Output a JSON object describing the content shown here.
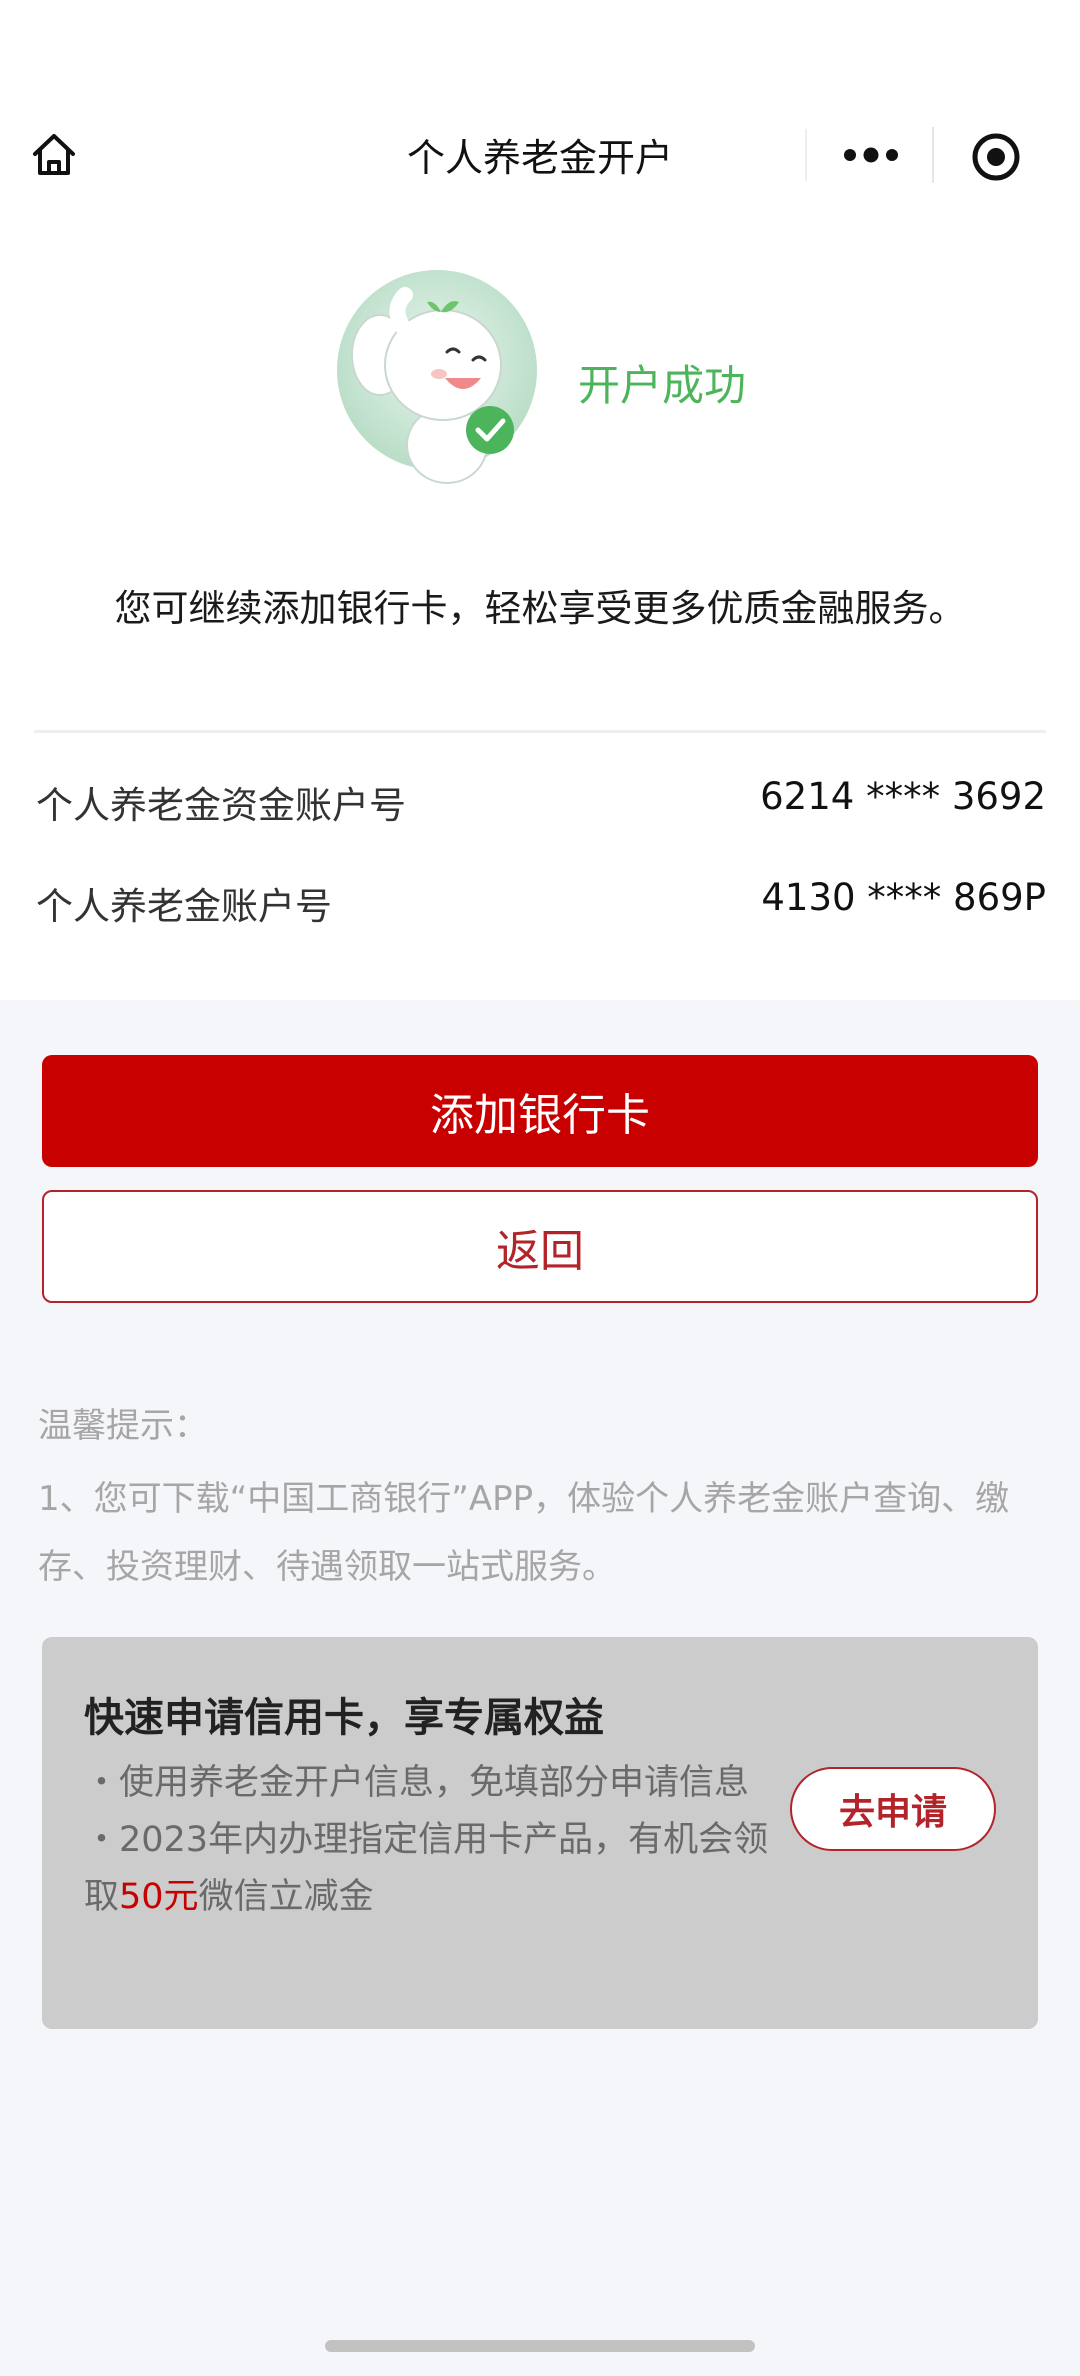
{
  "nav": {
    "title": "个人养老金开户",
    "home_icon": "home-icon",
    "more_icon": "more-dots-icon",
    "close_icon": "target-close-icon"
  },
  "success": {
    "mascot": "elephant-mascot-with-check",
    "status": "开户成功",
    "message": "您可继续添加银行卡，轻松享受更多优质金融服务。"
  },
  "accounts": [
    {
      "label": "个人养老金资金账户号",
      "value": "6214 **** 3692"
    },
    {
      "label": "个人养老金账户号",
      "value": "4130 **** 869P"
    }
  ],
  "actions": {
    "add_card": "添加银行卡",
    "back": "返回"
  },
  "tips": {
    "title": "温馨提示：",
    "items": [
      "1、您可下载“中国工商银行”APP，体验个人养老金账户查询、缴存、投资理财、待遇领取一站式服务。"
    ]
  },
  "promo": {
    "title": "快速申请信用卡，享专属权益",
    "bullet1": "・使用养老金开户信息，免填部分申请信息",
    "bullet2_prefix": "・2023年内办理指定信用卡产品，有机会领 取",
    "bullet2_highlight": "50元",
    "bullet2_suffix": "微信立减金",
    "button": "去申请"
  },
  "colors": {
    "brand_red": "#c90000",
    "success_green": "#4cb55c",
    "muted_text": "#a6a6a6",
    "promo_bg": "#cccccc"
  }
}
